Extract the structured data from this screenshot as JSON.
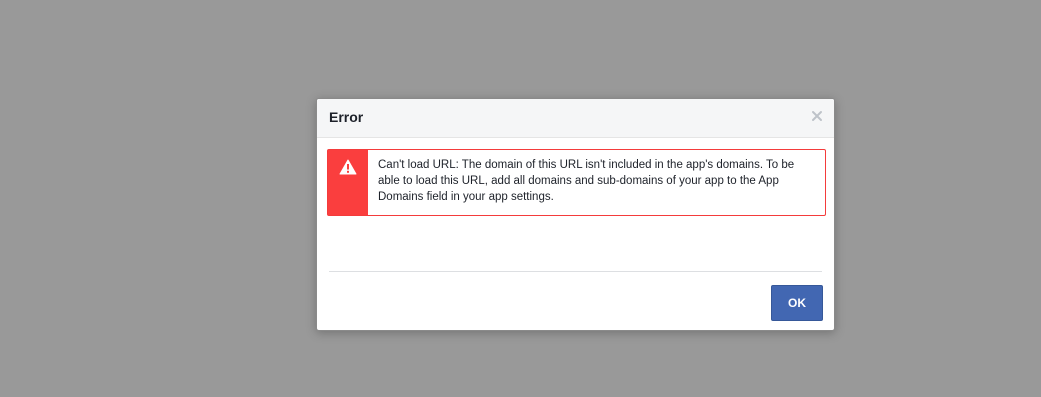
{
  "dialog": {
    "title": "Error",
    "close_icon": "close-icon",
    "error": {
      "icon": "warning-icon",
      "message": "Can't load URL: The domain of this URL isn't included in the app's domains. To be able to load this URL, add all domains and sub-domains of your app to the App Domains field in your app settings."
    },
    "ok_label": "OK"
  },
  "colors": {
    "backdrop": "#999999",
    "header_bg": "#f5f6f7",
    "error_red": "#fa3e3e",
    "button_blue": "#4267b2"
  }
}
